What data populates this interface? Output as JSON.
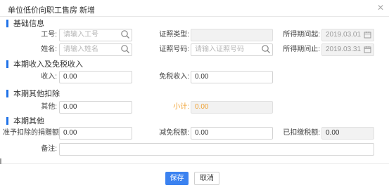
{
  "dialog": {
    "title": "单位低价向职工售房 新增",
    "close_glyph": "✕"
  },
  "sections": {
    "basic": "基础信息",
    "income": "本期收入及免税收入",
    "deduction": "本期其他扣除",
    "other": "本期其他"
  },
  "basic": {
    "emp_no_label": "工号:",
    "emp_no_placeholder": "请输入工号",
    "id_type_label": "证照类型:",
    "id_type_value": "",
    "period_start_label": "所得期间起:",
    "period_start_value": "2019.03.01",
    "name_label": "姓名:",
    "name_placeholder": "请输入姓名",
    "id_no_label": "证照号码:",
    "id_no_placeholder": "请输入证照号码",
    "period_end_label": "所得期间止:",
    "period_end_value": "2019.03.31"
  },
  "income": {
    "income_label": "收入:",
    "income_value": "0.00",
    "taxfree_label": "免税收入:",
    "taxfree_value": "0.00"
  },
  "deduction": {
    "other_label": "其他:",
    "other_value": "0.00",
    "subtotal_label": "小计:",
    "subtotal_value": "0.00"
  },
  "other": {
    "donation_label": "准予扣除的捐赠额:",
    "donation_value": "0.00",
    "tax_reduction_label": "减免税额:",
    "tax_reduction_value": "0.00",
    "withheld_label": "已扣缴税额:",
    "withheld_value": "0.00",
    "remark_label": "备注:",
    "remark_value": ""
  },
  "footer": {
    "save_label": "保存",
    "cancel_label": "取消"
  },
  "colors": {
    "accent": "#1f72e8",
    "primary_button": "#3b82f0",
    "subtotal": "#f0a030"
  },
  "icons": {
    "search": "search-icon",
    "calendar": "calendar-icon",
    "close": "close-icon"
  }
}
